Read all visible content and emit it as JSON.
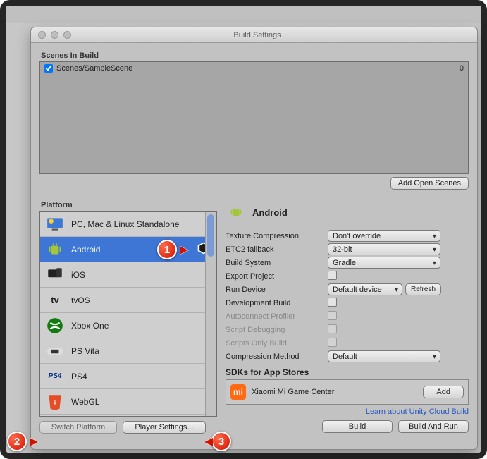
{
  "window": {
    "title": "Build Settings"
  },
  "scenes": {
    "header": "Scenes In Build",
    "items": [
      {
        "checked": true,
        "path": "Scenes/SampleScene",
        "index": "0"
      }
    ],
    "add_button": "Add Open Scenes"
  },
  "platform": {
    "header": "Platform",
    "items": [
      {
        "label": "PC, Mac & Linux Standalone",
        "icon": "desktop"
      },
      {
        "label": "Android",
        "icon": "android",
        "selected": true
      },
      {
        "label": "iOS",
        "icon": "ios"
      },
      {
        "label": "tvOS",
        "icon": "tvos"
      },
      {
        "label": "Xbox One",
        "icon": "xbox"
      },
      {
        "label": "PS Vita",
        "icon": "psvita"
      },
      {
        "label": "PS4",
        "icon": "ps4"
      },
      {
        "label": "WebGL",
        "icon": "webgl"
      }
    ],
    "switch_button": "Switch Platform",
    "player_settings_button": "Player Settings..."
  },
  "details": {
    "platform_name": "Android",
    "rows": {
      "texture_compression": {
        "label": "Texture Compression",
        "value": "Don't override"
      },
      "etc2_fallback": {
        "label": "ETC2 fallback",
        "value": "32-bit"
      },
      "build_system": {
        "label": "Build System",
        "value": "Gradle"
      },
      "export_project": {
        "label": "Export Project",
        "checked": false
      },
      "run_device": {
        "label": "Run Device",
        "value": "Default device",
        "refresh": "Refresh"
      },
      "development_build": {
        "label": "Development Build",
        "checked": false
      },
      "autoconnect_profiler": {
        "label": "Autoconnect Profiler",
        "checked": false,
        "disabled": true
      },
      "script_debugging": {
        "label": "Script Debugging",
        "checked": false,
        "disabled": true
      },
      "scripts_only_build": {
        "label": "Scripts Only Build",
        "checked": false,
        "disabled": true
      },
      "compression_method": {
        "label": "Compression Method",
        "value": "Default"
      }
    },
    "sdk": {
      "header": "SDKs for App Stores",
      "store": "Xiaomi Mi Game Center",
      "add": "Add"
    },
    "cloud_link": "Learn about Unity Cloud Build",
    "build": "Build",
    "build_and_run": "Build And Run"
  },
  "callouts": {
    "one": "1",
    "two": "2",
    "three": "3"
  }
}
